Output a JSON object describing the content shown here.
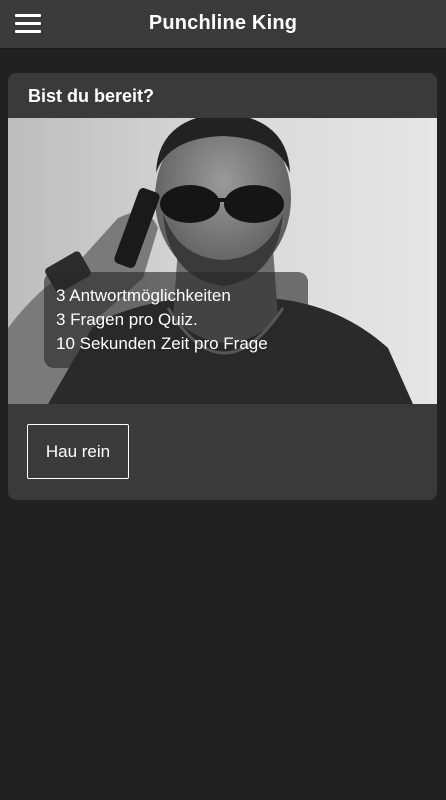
{
  "header": {
    "title": "Punchline King",
    "menu_icon": "hamburger-menu-icon"
  },
  "card": {
    "title": "Bist du bereit?",
    "image": "man-with-sunglasses-on-phone-photo",
    "info_lines": [
      "3 Antwortmöglichkeiten",
      "3 Fragen pro Quiz.",
      "10 Sekunden Zeit pro Frage"
    ],
    "button_label": "Hau rein"
  },
  "colors": {
    "background": "#212121",
    "header": "#3a3a3a",
    "card": "#3a3a3a",
    "text": "#ffffff"
  }
}
